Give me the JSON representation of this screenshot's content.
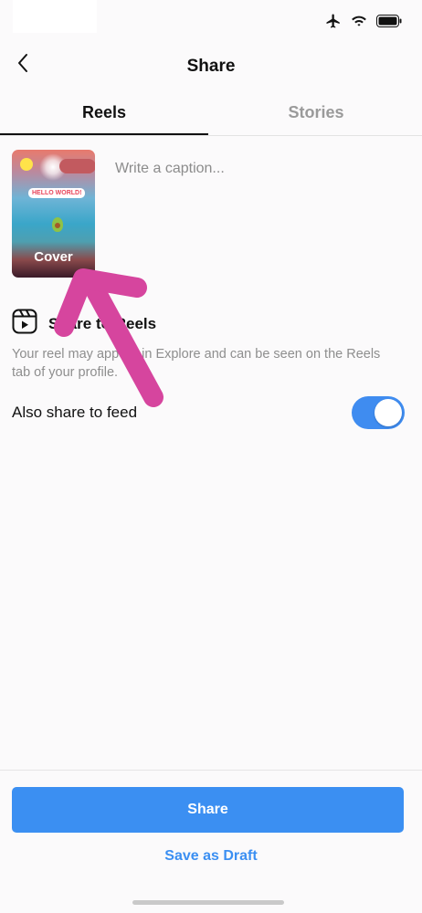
{
  "header": {
    "title": "Share"
  },
  "tabs": [
    {
      "label": "Reels",
      "active": true
    },
    {
      "label": "Stories",
      "active": false
    }
  ],
  "cover": {
    "label": "Cover",
    "sticker_text": "HELLO WORLD!"
  },
  "caption": {
    "placeholder": "Write a caption..."
  },
  "share_to_reels": {
    "title": "Share to Reels",
    "title_visible": "Sh…e   Reels",
    "description": "Your reel may appear in Explore and can be seen on the Reels tab of your profile."
  },
  "feed_toggle": {
    "label": "Also share to feed",
    "on": true
  },
  "actions": {
    "share_label": "Share",
    "draft_label": "Save as Draft"
  },
  "colors": {
    "accent": "#3b8ff2",
    "annotation_arrow": "#d6459e"
  }
}
